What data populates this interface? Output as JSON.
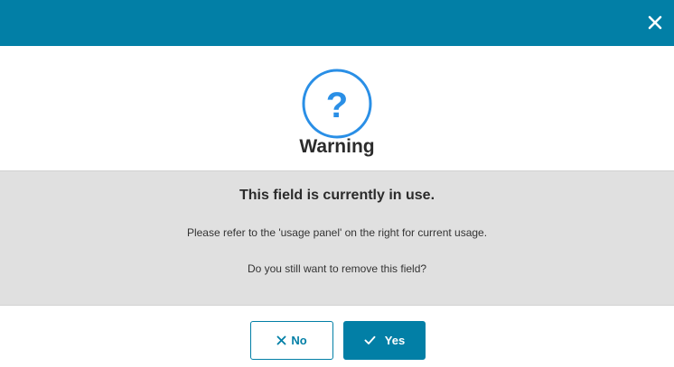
{
  "dialog": {
    "close_icon": "close-icon",
    "warning_icon": "question-circle-icon",
    "title": "Warning",
    "heading": "This field is currently in use.",
    "message_line1": "Please refer to the 'usage panel' on the right for current usage.",
    "message_line2": "Do you still want to remove this field?",
    "no_label": "No",
    "no_icon": "x-icon",
    "yes_label": "Yes",
    "yes_icon": "checkmark-icon",
    "question_mark": "?"
  },
  "colors": {
    "primary": "#027fa6",
    "icon_blue": "#2a8fe6",
    "panel_gray": "#e0e0e0",
    "text_dark": "#2b2b2b"
  }
}
